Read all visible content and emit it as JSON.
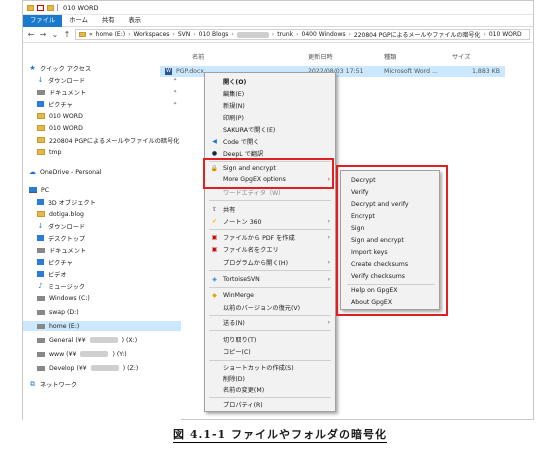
{
  "window": {
    "title": "010 WORD"
  },
  "ribbon": {
    "tabs": [
      "ファイル",
      "ホーム",
      "共有",
      "表示"
    ]
  },
  "address": {
    "segments": [
      "home (E:)",
      "Workspaces",
      "SVN",
      "010 Blogs",
      "trunk",
      "0400 Windows",
      "220804 PGPによるメールやファイルの暗号化",
      "010 WORD"
    ],
    "prefix": "«"
  },
  "sidebar": {
    "quick_access": "クイック アクセス",
    "quick_items": [
      "ダウンロード",
      "ドキュメント",
      "ピクチャ",
      "010 WORD",
      "010 WORD",
      "220804 PGPによるメールやファイルの暗号化",
      "tmp"
    ],
    "onedrive": "OneDrive - Personal",
    "pc": "PC",
    "pc_items": [
      "3D オブジェクト",
      "dotiga.blog",
      "ダウンロード",
      "デスクトップ",
      "ドキュメント",
      "ピクチャ",
      "ビデオ",
      "ミュージック",
      "Windows (C:)",
      "swap (D:)",
      "home (E:)"
    ],
    "net_drives": [
      {
        "prefix": "General (¥¥",
        "suffix": ") (X:)"
      },
      {
        "prefix": "www (¥¥",
        "suffix": ") (Y:)"
      },
      {
        "prefix": "Develop (¥¥",
        "suffix": ") (Z:)"
      }
    ],
    "network": "ネットワーク"
  },
  "file_list": {
    "headers": {
      "name": "名前",
      "date": "更新日時",
      "type": "種類",
      "size": "サイズ"
    },
    "row": {
      "name": "PGP.docx",
      "date": "2022/08/03 17:51",
      "type": "Microsoft Word ...",
      "size": "1,883 KB"
    }
  },
  "context_menu": {
    "items": [
      {
        "label": "開く(O)"
      },
      {
        "label": "編集(E)"
      },
      {
        "label": "新規(N)"
      },
      {
        "label": "印刷(P)"
      },
      {
        "label": "SAKURAで開く(E)"
      },
      {
        "label": "Code で開く"
      },
      {
        "label": "DeepL で翻訳"
      },
      {
        "label": "Sign and encrypt"
      },
      {
        "label": "More GpgEX options"
      },
      {
        "label": "ワードエディタ（W）"
      },
      {
        "label": "共有"
      },
      {
        "label": "ノートン 360"
      },
      {
        "label": "ファイルから PDF を作成"
      },
      {
        "label": "ファイル名をクエリ"
      },
      {
        "label": "プログラムから開く(H)"
      },
      {
        "label": "TortoiseSVN"
      },
      {
        "label": "WinMerge"
      },
      {
        "label": "以前のバージョンの復元(V)"
      },
      {
        "label": "送る(N)"
      },
      {
        "label": "切り取り(T)"
      },
      {
        "label": "コピー(C)"
      },
      {
        "label": "ショートカットの作成(S)"
      },
      {
        "label": "削除(D)"
      },
      {
        "label": "名前の変更(M)"
      },
      {
        "label": "プロパティ(R)"
      }
    ]
  },
  "gpgex_submenu": {
    "items": [
      "Decrypt",
      "Verify",
      "Decrypt and verify",
      "Encrypt",
      "Sign",
      "Sign and encrypt",
      "Import keys",
      "Create checksums",
      "Verify checksums",
      "Help on GpgEX",
      "About GpgEX"
    ]
  },
  "caption": "図 4.1-1  ファイルやフォルダの暗号化",
  "colors": {
    "accent": "#1979ca",
    "highlight": "#cce8ff",
    "callout": "#e02020"
  }
}
